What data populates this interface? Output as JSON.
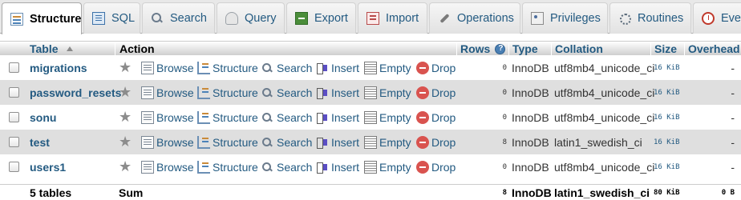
{
  "tabs": [
    {
      "label": "Structure",
      "icon": "structure-icon",
      "active": true
    },
    {
      "label": "SQL",
      "icon": "sql-icon"
    },
    {
      "label": "Search",
      "icon": "search-icon"
    },
    {
      "label": "Query",
      "icon": "query-icon"
    },
    {
      "label": "Export",
      "icon": "export-icon"
    },
    {
      "label": "Import",
      "icon": "import-icon"
    },
    {
      "label": "Operations",
      "icon": "operations-icon"
    },
    {
      "label": "Privileges",
      "icon": "privileges-icon"
    },
    {
      "label": "Routines",
      "icon": "routines-icon"
    },
    {
      "label": "Eve",
      "icon": "events-icon"
    }
  ],
  "table_header": {
    "table": "Table",
    "action": "Action",
    "rows": "Rows",
    "type": "Type",
    "collation": "Collation",
    "size": "Size",
    "overhead": "Overhead"
  },
  "actions": {
    "browse": "Browse",
    "structure": "Structure",
    "search": "Search",
    "insert": "Insert",
    "empty": "Empty",
    "drop": "Drop"
  },
  "rows": [
    {
      "name": "migrations",
      "rows": "0",
      "type": "InnoDB",
      "collation": "utf8mb4_unicode_ci",
      "size": "16 KiB",
      "overhead": "-"
    },
    {
      "name": "password_resets",
      "rows": "0",
      "type": "InnoDB",
      "collation": "utf8mb4_unicode_ci",
      "size": "16 KiB",
      "overhead": "-"
    },
    {
      "name": "sonu",
      "rows": "0",
      "type": "InnoDB",
      "collation": "utf8mb4_unicode_ci",
      "size": "16 KiB",
      "overhead": "-"
    },
    {
      "name": "test",
      "rows": "8",
      "type": "InnoDB",
      "collation": "latin1_swedish_ci",
      "size": "16 KiB",
      "overhead": "-"
    },
    {
      "name": "users1",
      "rows": "0",
      "type": "InnoDB",
      "collation": "utf8mb4_unicode_ci",
      "size": "16 KiB",
      "overhead": "-"
    }
  ],
  "footer": {
    "tables": "5 tables",
    "sum": "Sum",
    "rows": "8",
    "type": "InnoDB",
    "collation": "latin1_swedish_ci",
    "size": "80 KiB",
    "overhead": "0 B"
  },
  "colors": {
    "link": "#235a81",
    "row_even": "#dfdfdf",
    "drop_red": "#d9534f"
  }
}
